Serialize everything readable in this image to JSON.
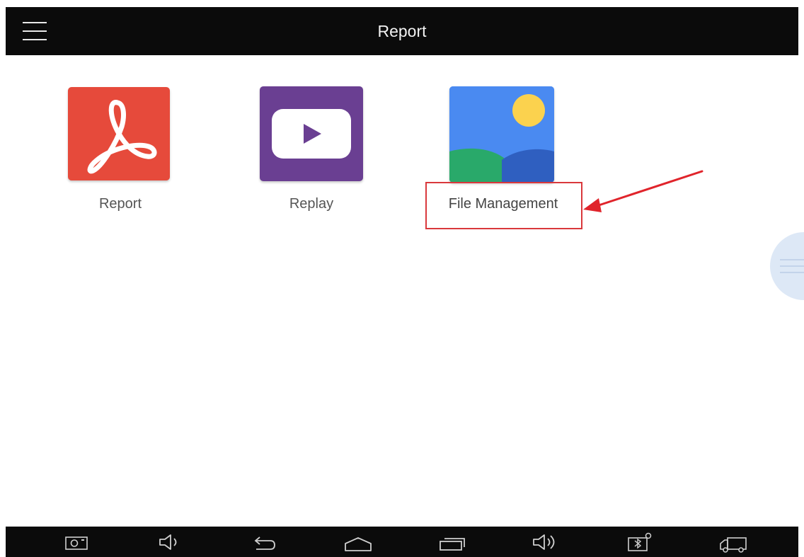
{
  "header": {
    "title": "Report",
    "menu_icon": "hamburger-menu-icon"
  },
  "apps": [
    {
      "label": "Report",
      "icon": "pdf-report-icon",
      "color": "#e64a3b"
    },
    {
      "label": "Replay",
      "icon": "play-video-icon",
      "color": "#6a3f92"
    },
    {
      "label": "File Management",
      "icon": "gallery-image-icon",
      "color": "#4a8af1"
    }
  ],
  "annotation": {
    "highlight_color": "#d9383c",
    "highlighted_item": "File Management"
  },
  "floating_button": {
    "icon": "floating-menu-icon"
  },
  "system_bar": {
    "icons": [
      "screenshot-icon",
      "volume-down-icon",
      "back-icon",
      "home-icon",
      "recent-apps-icon",
      "volume-up-icon",
      "vci-bluetooth-icon",
      "truck-icon"
    ]
  }
}
